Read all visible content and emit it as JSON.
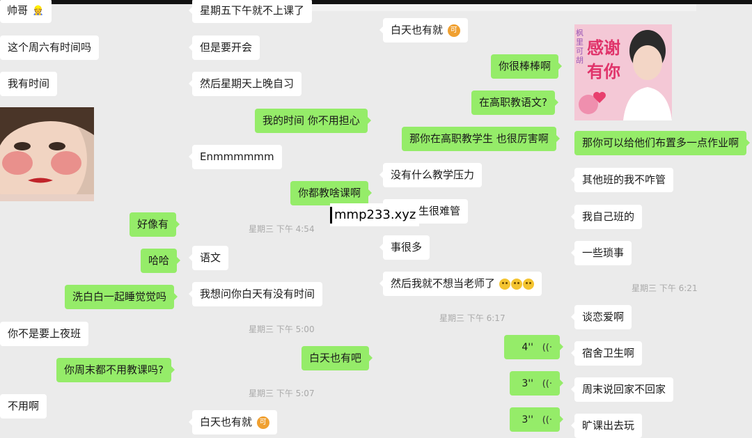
{
  "col1": {
    "m1": "帅哥",
    "m2": "这个周六有时间吗",
    "m3": "我有时间",
    "m4": "好像有",
    "m5": "哈哈",
    "m6": "洗白白一起睡觉觉吗",
    "m7": "你不是要上夜班",
    "m8": "你周末都不用教课吗?",
    "m9": "不用啊"
  },
  "col2": {
    "m1": "星期五下午就不上课了",
    "m2": "但是要开会",
    "m3": "然后星期天上晚自习",
    "m4": "我的时间 你不用担心",
    "m5": "Enmmmmmm",
    "m6": "你都教啥课啊",
    "ts1": "星期三 下午 4:54",
    "m7": "语文",
    "m8": "我想问你白天有没有时间",
    "ts2": "星期三 下午 5:00",
    "m9": "白天也有吧",
    "ts3": "星期三 下午 5:07",
    "m10": "白天也有就"
  },
  "col3": {
    "m1": "白天也有就",
    "m2": "你很棒棒啊",
    "m3": "在高职教语文?",
    "m4": "那你在高职教学生 也很厉害啊",
    "m5": "没有什么教学压力",
    "m6": "生很难管",
    "m7": "事很多",
    "m8": "然后我就不想当老师了",
    "ts1": "星期三 下午 6:17",
    "v1": "4''",
    "v2": "3''",
    "v3": "3''"
  },
  "col4": {
    "sticker_text_1": "感谢",
    "sticker_text_2": "有你",
    "sticker_side": "枫里可胡",
    "m1": "那你可以给他们布置多一点作业啊",
    "m2": "其他班的我不咋管",
    "m3": "我自己班的",
    "m4": "一些琐事",
    "ts1": "星期三 下午 6:21",
    "m5": "谈恋爱啊",
    "m6": "宿舍卫生啊",
    "m7": "周末说回家不回家",
    "m8": "旷课出去玩"
  },
  "icons": {
    "ke": "可",
    "voice": "((·"
  },
  "watermark": "mmp233.xyz"
}
